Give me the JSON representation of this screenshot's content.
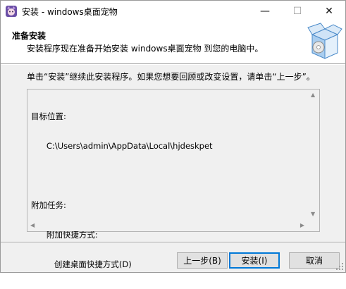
{
  "window": {
    "title": "安装 - windows桌面宠物"
  },
  "titlebar_buttons": {
    "minimize": "—",
    "maximize": "☐",
    "close": "✕"
  },
  "header": {
    "title": "准备安装",
    "subtitle": "安装程序现在准备开始安装 windows桌面宠物 到您的电脑中。"
  },
  "instruction": "单击“安装”继续此安装程序。如果您想要回顾或改变设置，请单击“上一步”。",
  "memo": {
    "lines": [
      "目标位置:",
      "      C:\\Users\\admin\\AppData\\Local\\hjdeskpet",
      "",
      "附加任务:",
      "      附加快捷方式:",
      "         创建桌面快捷方式(D)"
    ]
  },
  "buttons": {
    "back": "上一步(B)",
    "install": "安装(I)",
    "cancel": "取消"
  },
  "colors": {
    "accent": "#0078d7",
    "dialog_bg": "#f0f0f0"
  }
}
